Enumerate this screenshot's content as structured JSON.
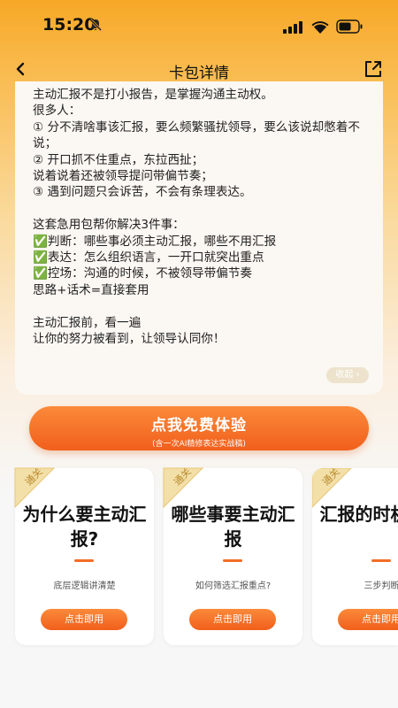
{
  "status": {
    "time": "15:20"
  },
  "nav": {
    "title": "卡包详情"
  },
  "description": {
    "text": "主动汇报不是打小报告，是掌握沟通主动权。\n很多人：\n① 分不清啥事该汇报，要么频繁骚扰领导，要么该说却憋着不说；\n② 开口抓不住重点，东拉西扯；\n说着说着还被领导提问带偏节奏；\n③ 遇到问题只会诉苦，不会有条理表达。\n\n这套急用包帮你解决3件事：\n✅判断：哪些事必须主动汇报，哪些不用汇报\n✅表达：怎么组织语言，一开口就突出重点\n✅控场：沟通的时候，不被领导带偏节奏\n思路+话术=直接套用\n\n主动汇报前，看一遍\n让你的努力被看到，让领导认同你！",
    "collapse_label": "收起 ›"
  },
  "cta": {
    "main": "点我免费体验",
    "sub": "(含一次AI精修表达实战稿)"
  },
  "cards": [
    {
      "badge": "通关",
      "title": "为什么要主动汇报?",
      "subtitle": "底层逻辑讲清楚",
      "button": "点击即用"
    },
    {
      "badge": "通关",
      "title": "哪些事要主动汇报",
      "subtitle": "如何筛选汇报重点?",
      "button": "点击即用"
    },
    {
      "badge": "通关",
      "title": "汇报的时机选择",
      "subtitle": "三步判断",
      "button": "点击即用"
    }
  ],
  "colors": {
    "accent": "#f26d26",
    "header_gradient_top": "#f7a826",
    "badge": "#f0d79a"
  }
}
